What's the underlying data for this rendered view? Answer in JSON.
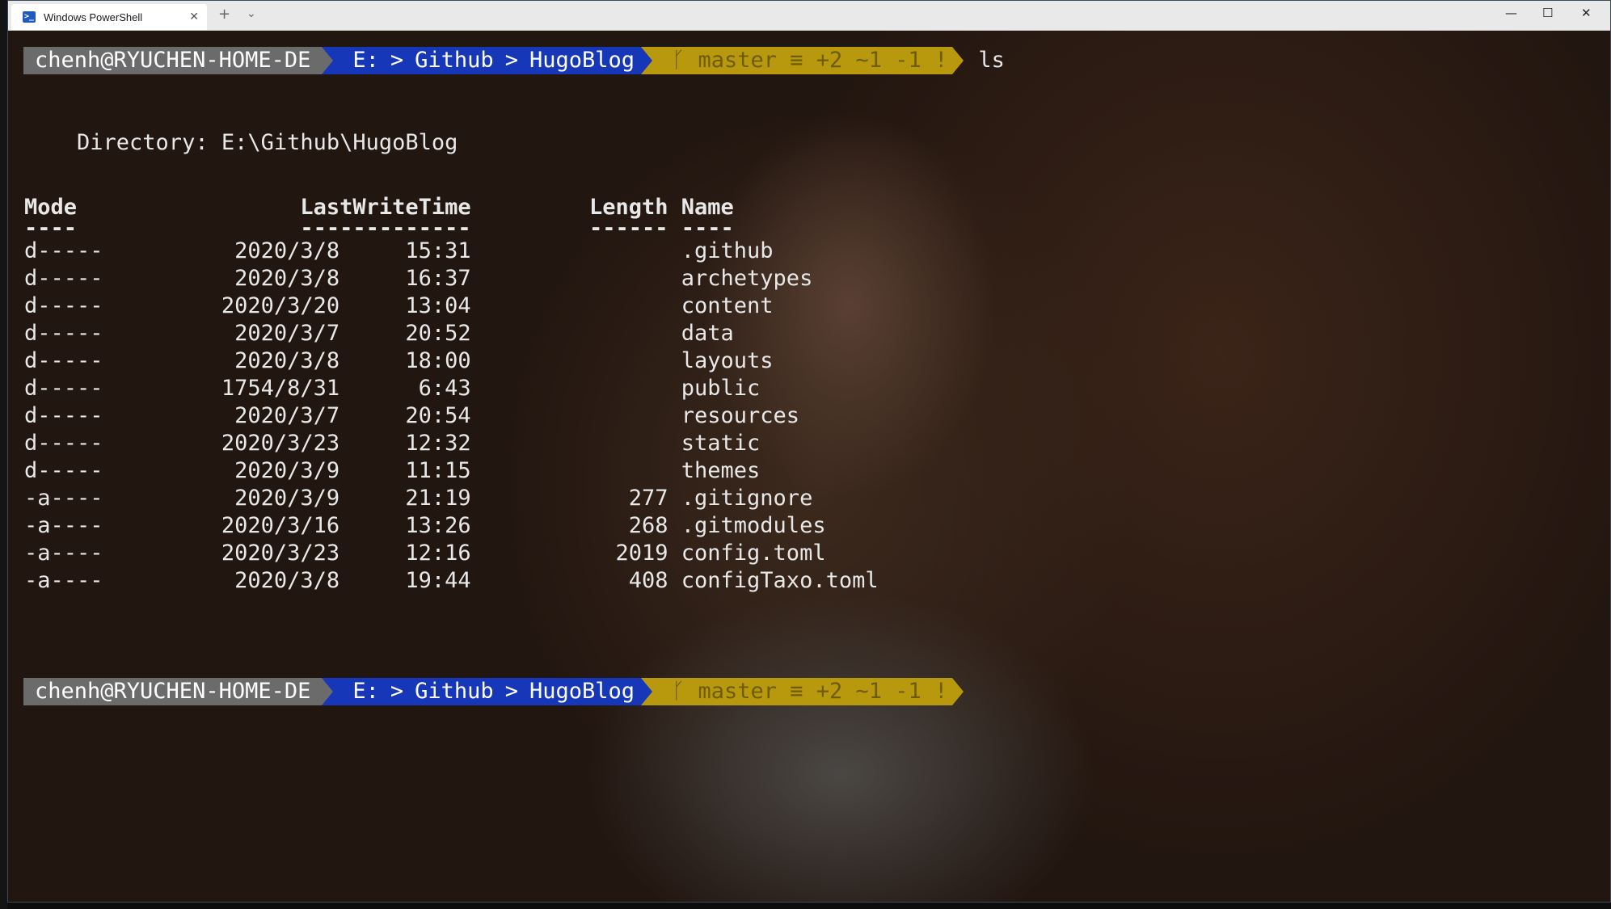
{
  "window": {
    "tab_title": "Windows PowerShell",
    "tab_icon": "powershell-icon",
    "new_tab": "+",
    "dropdown": "⌄",
    "minimize": "—",
    "maximize": "☐",
    "close": "✕"
  },
  "prompt": {
    "user": "chenh@RYUCHEN-HOME-DE",
    "path_parts": [
      "E:",
      "Github",
      "HugoBlog"
    ],
    "git": "ᚴ master ≡ +2 ~1 -1 !",
    "command": "ls"
  },
  "directory_line": "    Directory: E:\\Github\\HugoBlog",
  "table": {
    "header": "Mode                 LastWriteTime         Length Name",
    "underline": "----                 -------------         ------ ----",
    "rows": [
      "d-----          2020/3/8     15:31                .github",
      "d-----          2020/3/8     16:37                archetypes",
      "d-----         2020/3/20     13:04                content",
      "d-----          2020/3/7     20:52                data",
      "d-----          2020/3/8     18:00                layouts",
      "d-----         1754/8/31      6:43                public",
      "d-----          2020/3/7     20:54                resources",
      "d-----         2020/3/23     12:32                static",
      "d-----          2020/3/9     11:15                themes",
      "-a----          2020/3/9     21:19            277 .gitignore",
      "-a----         2020/3/16     13:26            268 .gitmodules",
      "-a----         2020/3/23     12:16           2019 config.toml",
      "-a----          2020/3/8     19:44            408 configTaxo.toml"
    ]
  },
  "colors": {
    "prompt_user_bg": "#6b6b6b",
    "prompt_path_bg": "#1638b8",
    "prompt_git_bg": "#b8980c",
    "text": "#e8e8e8"
  }
}
